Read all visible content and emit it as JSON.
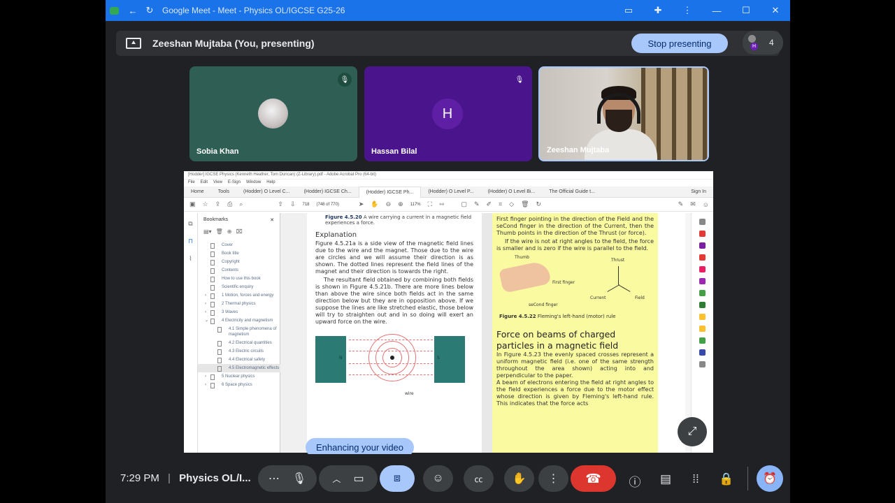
{
  "window": {
    "title": "Google Meet - Meet - Physics OL/IGCSE G25-26",
    "colors": {
      "titlebar": "#1a73e8",
      "background": "#202124",
      "accent": "#a8c7fa",
      "hangup": "#dc362e"
    }
  },
  "presenting": {
    "text": "Zeeshan Mujtaba (You, presenting)",
    "stop_label": "Stop presenting",
    "participant_count": "4",
    "mini_avatar_letter": "H"
  },
  "participants": [
    {
      "name": "Sobia Khan",
      "muted": true,
      "avatar": "photo"
    },
    {
      "name": "Hassan Bilal",
      "muted": true,
      "initial": "H"
    },
    {
      "name": "Zeeshan Mujtaba",
      "muted": false,
      "avatar": "video"
    }
  ],
  "shared": {
    "acro_title": "[Hodder] IGCSE Physics (Kenneth Heather, Tom Duncan) (Z-Library).pdf - Adobe Acrobat Pro (64-bit)",
    "menu": [
      "File",
      "Edit",
      "View",
      "E-Sign",
      "Window",
      "Help"
    ],
    "tabs": [
      "Home",
      "Tools",
      "(Hodder) O Level C...",
      "(Hodder) IGCSE Ch...",
      "(Hodder) IGCSE Ph...",
      "(Hodder) O Level P...",
      "(Hodder) O Level Bi...",
      "The Official Guide t..."
    ],
    "sign_in": "Sign In",
    "page_num": "718",
    "page_of": "(748 of 770)",
    "zoom": "117%",
    "bookmarks_title": "Bookmarks",
    "bookmarks": [
      {
        "label": "Cover"
      },
      {
        "label": "Book title"
      },
      {
        "label": "Copyright"
      },
      {
        "label": "Contents"
      },
      {
        "label": "How to use this book"
      },
      {
        "label": "Scientific enquiry"
      },
      {
        "label": "1 Motion, forces and energy",
        "expandable": true
      },
      {
        "label": "2 Thermal physics",
        "expandable": true
      },
      {
        "label": "3 Waves",
        "expandable": true
      },
      {
        "label": "4 Electricity and magnetism",
        "expandable": true,
        "open": true
      },
      {
        "label": "4.1 Simple phenomena of magnetism",
        "child": true
      },
      {
        "label": "4.2 Electrical quantities",
        "child": true
      },
      {
        "label": "4.3 Electric circuits",
        "child": true
      },
      {
        "label": "4.4 Electrical safety",
        "child": true
      },
      {
        "label": "4.5 Electromagnetic effects",
        "child": true,
        "selected": true
      },
      {
        "label": "5 Nuclear physics",
        "expandable": true
      },
      {
        "label": "6 Space physics",
        "expandable": true
      }
    ],
    "left_page": {
      "fig_label": "Figure 4.5.20",
      "fig_text": "A wire carrying a current in a magnetic field experiences a force.",
      "heading": "Explanation",
      "para1": "Figure 4.5.21a is a side view of the magnetic field lines due to the wire and the magnet. Those due to the wire are circles and we will assume their direction is as shown. The dotted lines represent the field lines of the magnet and their direction is towards the right.",
      "para2": "The resultant field obtained by combining both fields is shown in Figure 4.5.21b. There are more lines below than above the wire since both fields act in the same direction below but they are in opposition above. If we suppose the lines are like stretched elastic, those below will try to straighten out and in so doing will exert an upward force on the wire.",
      "north": "N",
      "south": "S",
      "wire": "wire"
    },
    "right_page": {
      "para1": "First finger pointing in the direction of the Field and the seCond finger in the direction of the Current, then the Thumb points in the direction of the Thrust (or force).",
      "para2": "If the wire is not at right angles to the field, the force is smaller and is zero if the wire is parallel to the field.",
      "labels": {
        "thumb": "Thumb",
        "first": "First finger",
        "second": "seCond finger",
        "thrust": "Thrust",
        "current": "Current",
        "field": "Field"
      },
      "fig_label": "Figure 4.5.22",
      "fig_text": "Fleming's left-hand (motor) rule",
      "heading": "Force on beams of charged particles in a magnetic field",
      "para3": "In Figure 4.5.23 the evenly spaced crosses represent a uniform magnetic field (i.e. one of the same strength throughout the area shown) acting into and perpendicular to the paper.",
      "para4": "A beam of electrons entering the field at right angles to the field experiences a force due to the motor effect whose direction is given by Fleming's left-hand rule. This indicates that the force acts"
    }
  },
  "enhance_label": "Enhancing your video",
  "bottom": {
    "time": "7:29 PM",
    "meeting": "Physics OL/I...",
    "icons": [
      "more-icon",
      "mic-icon",
      "chevron-up-icon",
      "camera-icon",
      "present-icon",
      "emoji-icon",
      "captions-icon",
      "raise-hand-icon",
      "more-vert-icon",
      "hangup-icon",
      "info-icon",
      "chat-icon",
      "activities-icon",
      "host-controls-icon",
      "timer-icon"
    ]
  }
}
